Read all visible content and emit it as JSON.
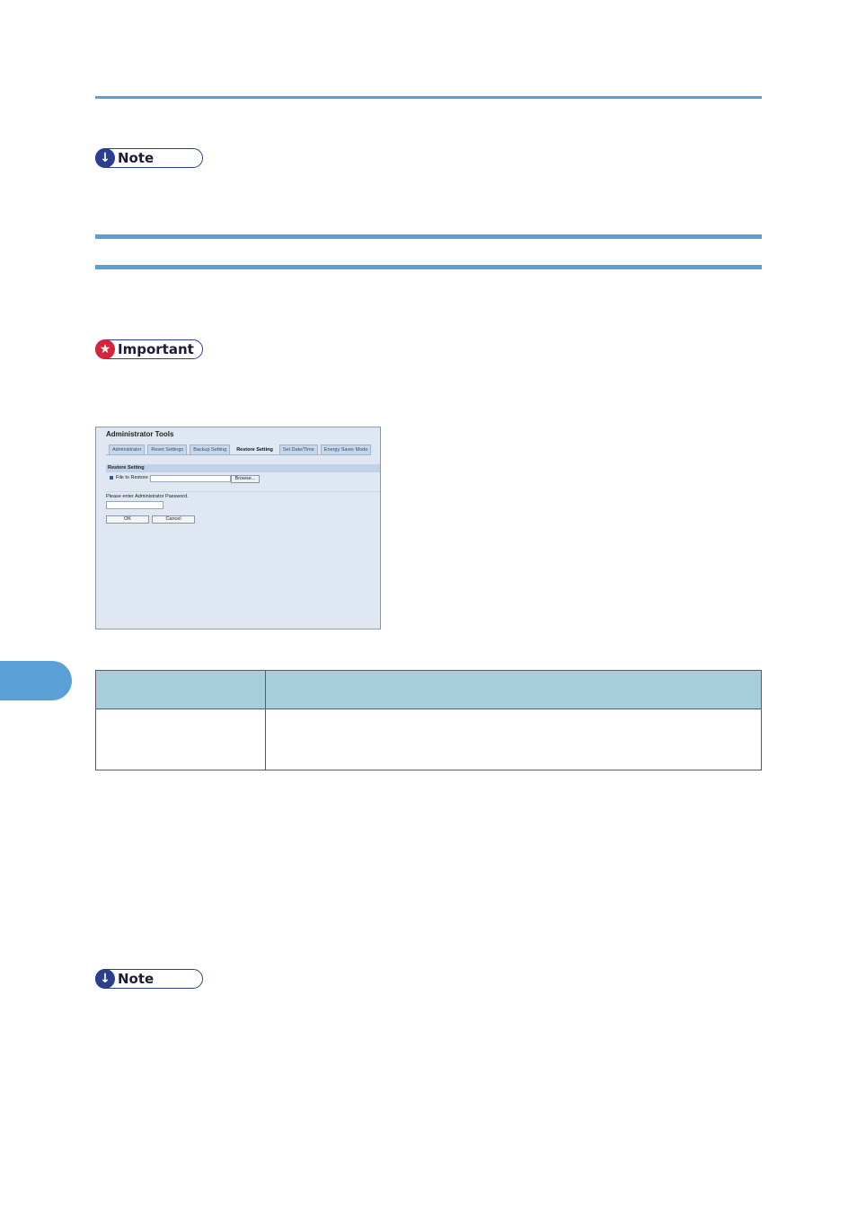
{
  "notes": {
    "note_label": "Note",
    "important_label": "Important"
  },
  "screenshot": {
    "title": "Administrator Tools",
    "tabs": [
      "Administrator",
      "Reset Settings",
      "Backup Setting",
      "Restore Setting",
      "Set Date/Time",
      "Energy Saver Mode"
    ],
    "active_tab": "Restore Setting",
    "section_title": "Restore Setting",
    "file_label": "File to Restore :",
    "browse_label": "Browse...",
    "password_prompt": "Please enter Administrator Password.",
    "ok_label": "OK",
    "cancel_label": "Cancel"
  },
  "colors": {
    "accent": "#5aa0d6",
    "note_badge": "#2c3f8c",
    "important_badge": "#d8243a",
    "table_header": "#a8cddd"
  }
}
